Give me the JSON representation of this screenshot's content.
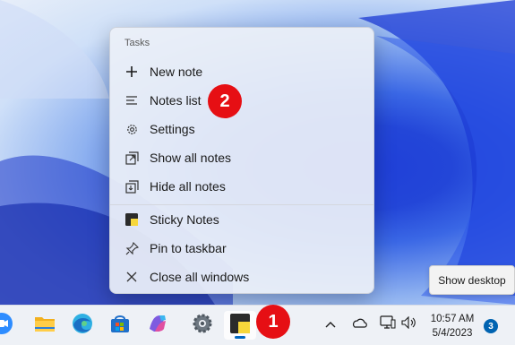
{
  "jumplist": {
    "heading": "Tasks",
    "tasks": [
      {
        "label": "New note",
        "icon": "plus-icon"
      },
      {
        "label": "Notes list",
        "icon": "list-icon"
      },
      {
        "label": "Settings",
        "icon": "gear-icon"
      },
      {
        "label": "Show all notes",
        "icon": "show-notes-icon"
      },
      {
        "label": "Hide all notes",
        "icon": "hide-notes-icon"
      }
    ],
    "app_items": [
      {
        "label": "Sticky Notes",
        "icon": "sticky-notes-icon"
      },
      {
        "label": "Pin to taskbar",
        "icon": "pin-icon"
      },
      {
        "label": "Close all windows",
        "icon": "close-icon"
      }
    ]
  },
  "callouts": {
    "first": "1",
    "second": "2"
  },
  "tooltip": {
    "label": "Show desktop"
  },
  "taskbar": {
    "apps": [
      "zoom-icon",
      "file-explorer-icon",
      "edge-icon",
      "microsoft-store-icon",
      "copilot-icon",
      "settings-icon",
      "sticky-notes-icon"
    ],
    "tray": [
      "chevron-up-icon",
      "onedrive-icon",
      "network-icon",
      "volume-icon"
    ],
    "time": "10:57 AM",
    "date": "5/4/2023",
    "notification_count": "3"
  },
  "colors": {
    "accent": "#0067c0",
    "callout": "#e60f14",
    "sticky_yellow": "#f7d73b"
  }
}
